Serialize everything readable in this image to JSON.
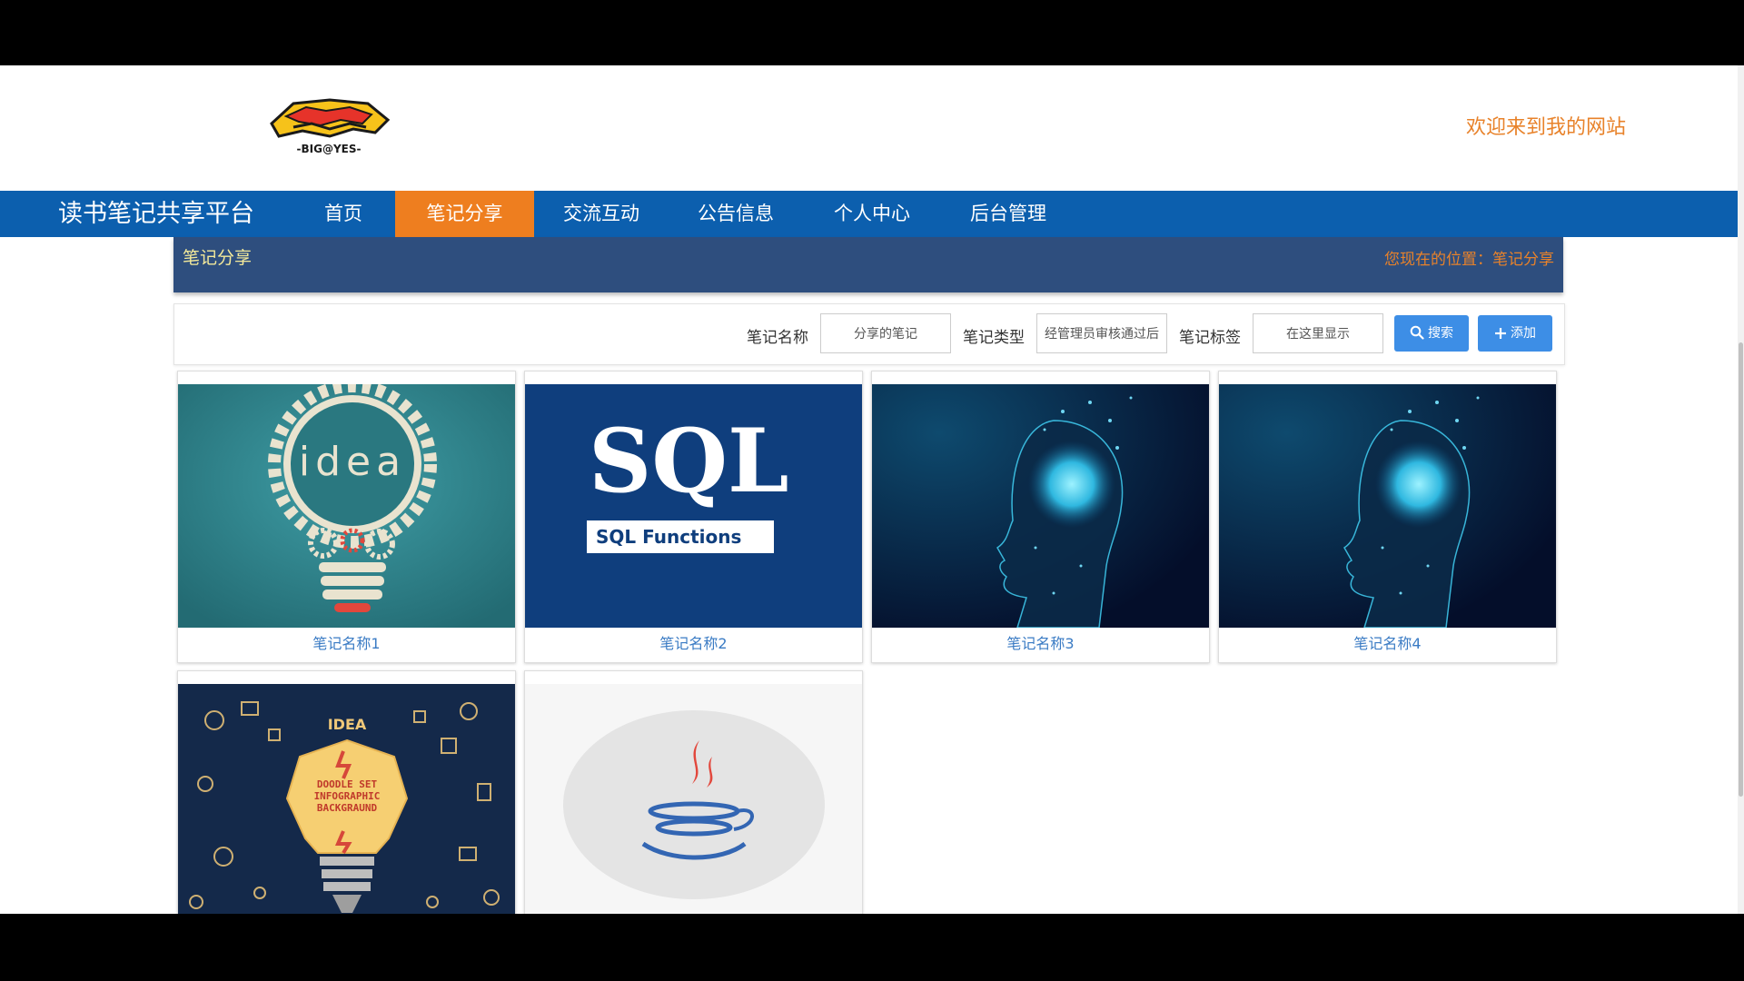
{
  "header": {
    "welcome": "欢迎来到我的网站"
  },
  "navbar": {
    "site_title": "读书笔记共享平台",
    "items": [
      {
        "label": "首页"
      },
      {
        "label": "笔记分享"
      },
      {
        "label": "交流互动"
      },
      {
        "label": "公告信息"
      },
      {
        "label": "个人中心"
      },
      {
        "label": "后台管理"
      }
    ],
    "active_index": 1
  },
  "breadcrumb": {
    "title": "笔记分享",
    "location": "您现在的位置：笔记分享"
  },
  "search": {
    "name_label": "笔记名称",
    "name_value": "分享的笔记",
    "type_label": "笔记类型",
    "type_value": "经管理员审核通过后",
    "tag_label": "笔记标签",
    "tag_value": "在这里显示",
    "search_button": "搜索",
    "add_button": "添加"
  },
  "cards": [
    {
      "name": "笔记名称1",
      "image": "idea-lightbulb-gear",
      "image_text": "idea"
    },
    {
      "name": "笔记名称2",
      "image": "sql-functions",
      "image_text": "SQL",
      "image_subtext": "SQL Functions"
    },
    {
      "name": "笔记名称3",
      "image": "ai-brain-head"
    },
    {
      "name": "笔记名称4",
      "image": "ai-brain-head"
    },
    {
      "name": "",
      "image": "doodle-lightbulb",
      "image_text": "DOODLE SET INFOGRAPHIC BACKGRAUND",
      "image_badge": "IDEA"
    },
    {
      "name": "",
      "image": "java-logo"
    }
  ],
  "colors": {
    "nav_bg": "#0c5fae",
    "nav_active": "#ee7e1f",
    "crumb_bg": "#2e4e7e",
    "accent_orange": "#e8822a",
    "button_blue": "#3d8ee6",
    "link_blue": "#3a7bc4"
  }
}
